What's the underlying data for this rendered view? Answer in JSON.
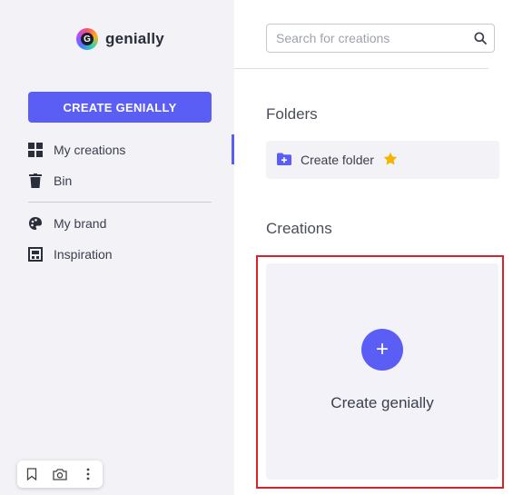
{
  "sidebar": {
    "logo_text": "genially",
    "create_button": "CREATE GENIALLY",
    "items": [
      {
        "label": "My creations",
        "icon": "grid-icon"
      },
      {
        "label": "Bin",
        "icon": "trash-icon"
      },
      {
        "label": "My brand",
        "icon": "palette-icon"
      },
      {
        "label": "Inspiration",
        "icon": "inspiration-icon"
      }
    ]
  },
  "search": {
    "placeholder": "Search for creations"
  },
  "main": {
    "folders_title": "Folders",
    "create_folder_label": "Create folder",
    "creations_title": "Creations",
    "create_card_label": "Create genially",
    "create_card_plus": "+"
  },
  "colors": {
    "accent": "#5a5ef5",
    "sidebar_bg": "#f2f2f7",
    "highlight_border": "#d9232a",
    "star": "#f5b400"
  }
}
